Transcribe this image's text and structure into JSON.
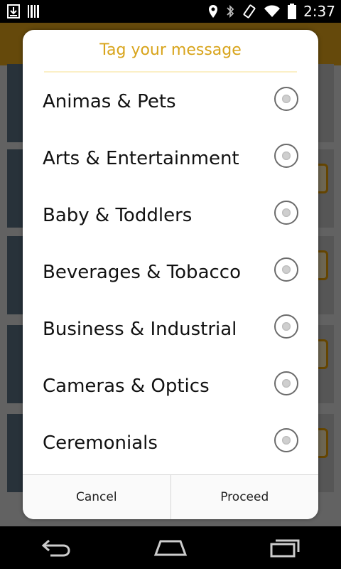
{
  "status_bar": {
    "time": "2:37",
    "left_icons": [
      "download-icon",
      "barcode-icon"
    ],
    "right_icons": [
      "location-icon",
      "bluetooth-icon",
      "rotate-icon",
      "wifi-icon",
      "battery-icon"
    ]
  },
  "dialog": {
    "title": "Tag your message",
    "options": [
      {
        "label": "Animas & Pets",
        "selected": false
      },
      {
        "label": "Arts & Entertainment",
        "selected": false
      },
      {
        "label": "Baby & Toddlers",
        "selected": false
      },
      {
        "label": "Beverages & Tobacco",
        "selected": false
      },
      {
        "label": "Business & Industrial",
        "selected": false
      },
      {
        "label": "Cameras & Optics",
        "selected": false
      },
      {
        "label": "Ceremonials",
        "selected": false
      }
    ],
    "buttons": {
      "cancel": "Cancel",
      "proceed": "Proceed"
    }
  },
  "nav_bar": {
    "buttons": [
      "back-icon",
      "home-icon",
      "recents-icon"
    ]
  },
  "colors": {
    "accent": "#d8a41b",
    "header": "#e0a21a"
  }
}
